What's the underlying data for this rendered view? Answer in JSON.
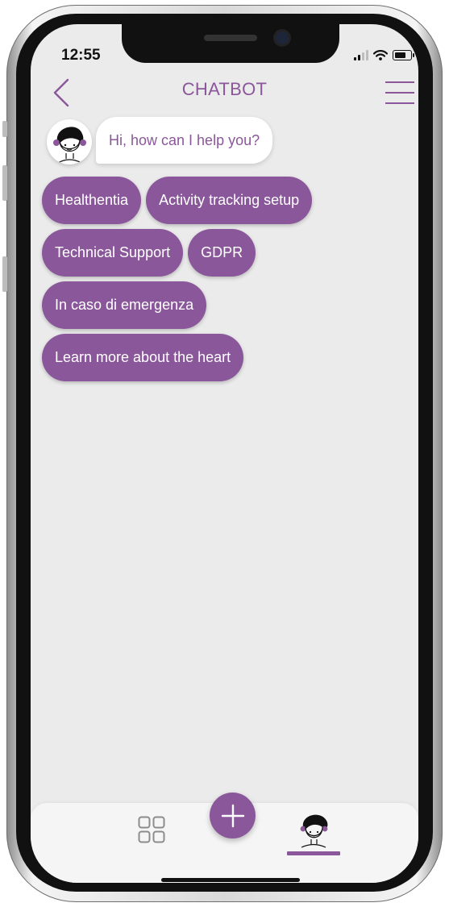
{
  "status_bar": {
    "time": "12:55",
    "signal_bars": 4,
    "signal_active": 2,
    "battery_level": 0.8
  },
  "header": {
    "title": "CHATBOT",
    "back_icon": "chevron-left-icon",
    "menu_icon": "hamburger-menu-icon"
  },
  "chat": {
    "bot_avatar": "avatar-icon",
    "message": "Hi, how can I help you?"
  },
  "options": [
    [
      "Healthentia",
      "Activity tracking setup"
    ],
    [
      "Technical Support",
      "GDPR"
    ],
    [
      "In caso di emergenza"
    ],
    [
      "Learn more about the heart"
    ]
  ],
  "bottom_nav": {
    "items": [
      "dashboard-grid-icon",
      "add-plus-icon",
      "chatbot-avatar-icon"
    ],
    "active_item": "chatbot-avatar-icon"
  },
  "colors": {
    "accent": "#8a579a",
    "background": "#ebebeb",
    "bubble": "#ffffff"
  }
}
